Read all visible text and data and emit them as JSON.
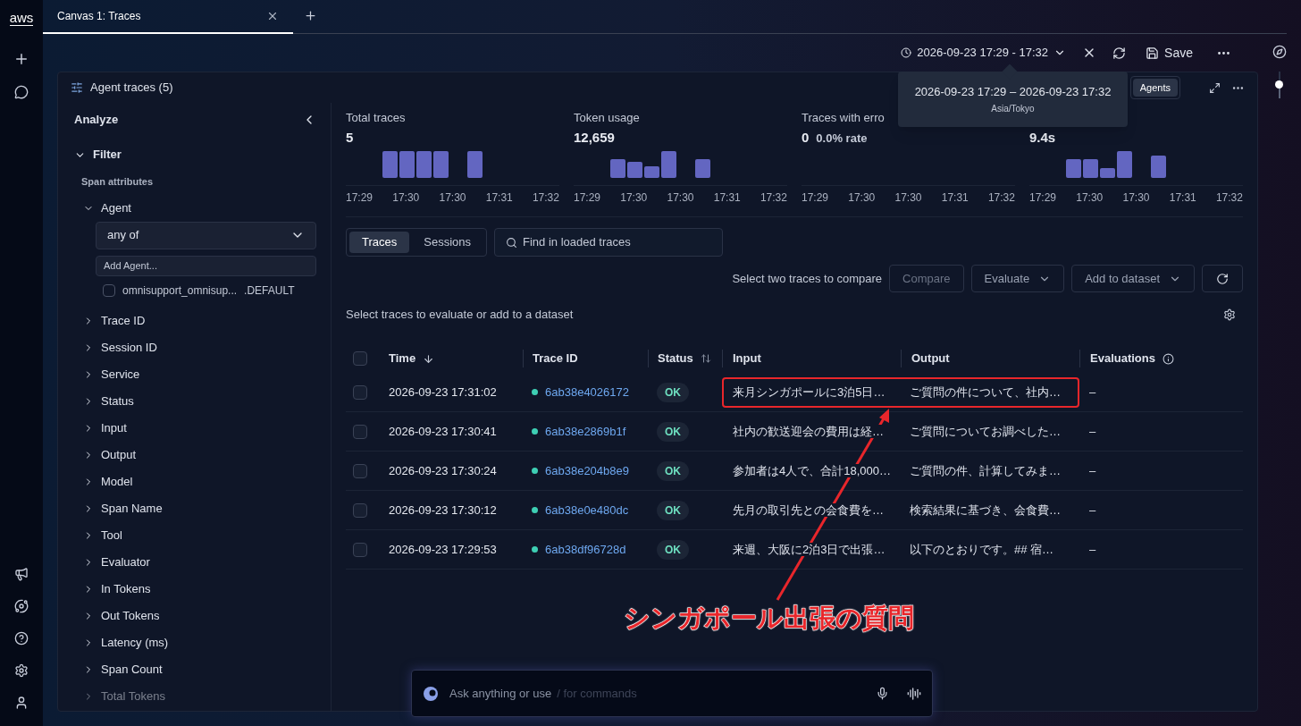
{
  "rail": {
    "logo": "aws"
  },
  "tabs": [
    {
      "label": "Canvas 1: Traces",
      "selected": true
    }
  ],
  "toolbar": {
    "time_range": "2026-09-23 17:29 - 17:32",
    "save": "Save"
  },
  "tooltip": {
    "range": "2026-09-23 17:29 – 2026-09-23 17:32",
    "timezone": "Asia/Tokyo"
  },
  "panel": {
    "title": "Agent traces (5)",
    "view_options": [
      {
        "label": "Agents",
        "selected": true
      }
    ]
  },
  "analyze": {
    "title": "Analyze",
    "filter": "Filter",
    "section": "Span attributes",
    "filters": [
      {
        "label": "Agent",
        "expanded": true,
        "operator": "any of",
        "add_placeholder": "Add Agent...",
        "options": [
          {
            "label": "omnisupport_omnisup...",
            "suffix": ".DEFAULT",
            "checked": false
          }
        ]
      },
      {
        "label": "Trace ID",
        "expanded": false
      },
      {
        "label": "Session ID",
        "expanded": false
      },
      {
        "label": "Service",
        "expanded": false
      },
      {
        "label": "Status",
        "expanded": false
      },
      {
        "label": "Input",
        "expanded": false
      },
      {
        "label": "Output",
        "expanded": false
      },
      {
        "label": "Model",
        "expanded": false
      },
      {
        "label": "Span Name",
        "expanded": false
      },
      {
        "label": "Tool",
        "expanded": false
      },
      {
        "label": "Evaluator",
        "expanded": false
      },
      {
        "label": "In Tokens",
        "expanded": false
      },
      {
        "label": "Out Tokens",
        "expanded": false
      },
      {
        "label": "Latency (ms)",
        "expanded": false
      },
      {
        "label": "Span Count",
        "expanded": false
      },
      {
        "label": "Total Tokens",
        "expanded": false
      }
    ]
  },
  "metrics": [
    {
      "title": "Total traces",
      "value": "5",
      "ticks": [
        "17:29",
        "17:30",
        "17:30",
        "17:31",
        "17:32"
      ]
    },
    {
      "title": "Token usage",
      "value": "12,659",
      "ticks": [
        "17:29",
        "17:30",
        "17:30",
        "17:31",
        "17:32"
      ]
    },
    {
      "title": "Traces with erro",
      "value": "0",
      "sub": "0.0% rate",
      "ticks": [
        "17:29",
        "17:30",
        "17:30",
        "17:31",
        "17:32"
      ]
    },
    {
      "value": "9.4s",
      "ticks": [
        "17:29",
        "17:30",
        "17:30",
        "17:31",
        "17:32"
      ]
    }
  ],
  "view_tabs": [
    {
      "label": "Traces",
      "selected": true
    },
    {
      "label": "Sessions",
      "selected": false
    }
  ],
  "search": {
    "placeholder": "Find in loaded traces"
  },
  "actions": {
    "hint": "Select two traces to compare",
    "buttons": [
      {
        "label": "Compare",
        "kind": "plain",
        "disabled": true
      },
      {
        "label": "Evaluate",
        "kind": "dropdown",
        "disabled": false
      },
      {
        "label": "Add to dataset",
        "kind": "dropdown",
        "disabled": false
      }
    ]
  },
  "note": "Select traces to evaluate or add to a dataset",
  "zoom": {
    "level": 0.5
  },
  "table": {
    "select_all_checked": false,
    "columns": [
      {
        "label": "Time",
        "kind": "sort"
      },
      {
        "label": "Trace ID",
        "kind": "plain"
      },
      {
        "label": "Status",
        "kind": "sortable"
      },
      {
        "label": "Input",
        "kind": "plain"
      },
      {
        "label": "Output",
        "kind": "plain"
      },
      {
        "label": "Evaluations",
        "kind": "info"
      }
    ],
    "rows": [
      {
        "checked": false,
        "highlighted": true,
        "time": "2026-09-23 17:31:02",
        "trace_id": "6ab38e4026172",
        "status": "OK",
        "input": "来月シンガポールに3泊5日…",
        "output": "ご質問の件について、社内…",
        "evaluations": "–"
      },
      {
        "checked": false,
        "highlighted": false,
        "time": "2026-09-23 17:30:41",
        "trace_id": "6ab38e2869b1f",
        "status": "OK",
        "input": "社内の歓送迎会の費用は経…",
        "output": "ご質問についてお調べした…",
        "evaluations": "–"
      },
      {
        "checked": false,
        "highlighted": false,
        "time": "2026-09-23 17:30:24",
        "trace_id": "6ab38e204b8e9",
        "status": "OK",
        "input": "参加者は4人で、合計18,000…",
        "output": "ご質問の件、計算してみま…",
        "evaluations": "–"
      },
      {
        "checked": false,
        "highlighted": false,
        "time": "2026-09-23 17:30:12",
        "trace_id": "6ab38e0e480dc",
        "status": "OK",
        "input": "先月の取引先との会食費を…",
        "output": "検索結果に基づき、会食費…",
        "evaluations": "–"
      },
      {
        "checked": false,
        "highlighted": false,
        "time": "2026-09-23 17:29:53",
        "trace_id": "6ab38df96728d",
        "status": "OK",
        "input": "来週、大阪に2泊3日で出張…",
        "output": "以下のとおりです。## 宿…",
        "evaluations": "–"
      }
    ]
  },
  "annotation": {
    "caption": "シンガポール出張の質問"
  },
  "chat": {
    "placeholder": "Ask anything or use",
    "hint": "/ for commands"
  }
}
